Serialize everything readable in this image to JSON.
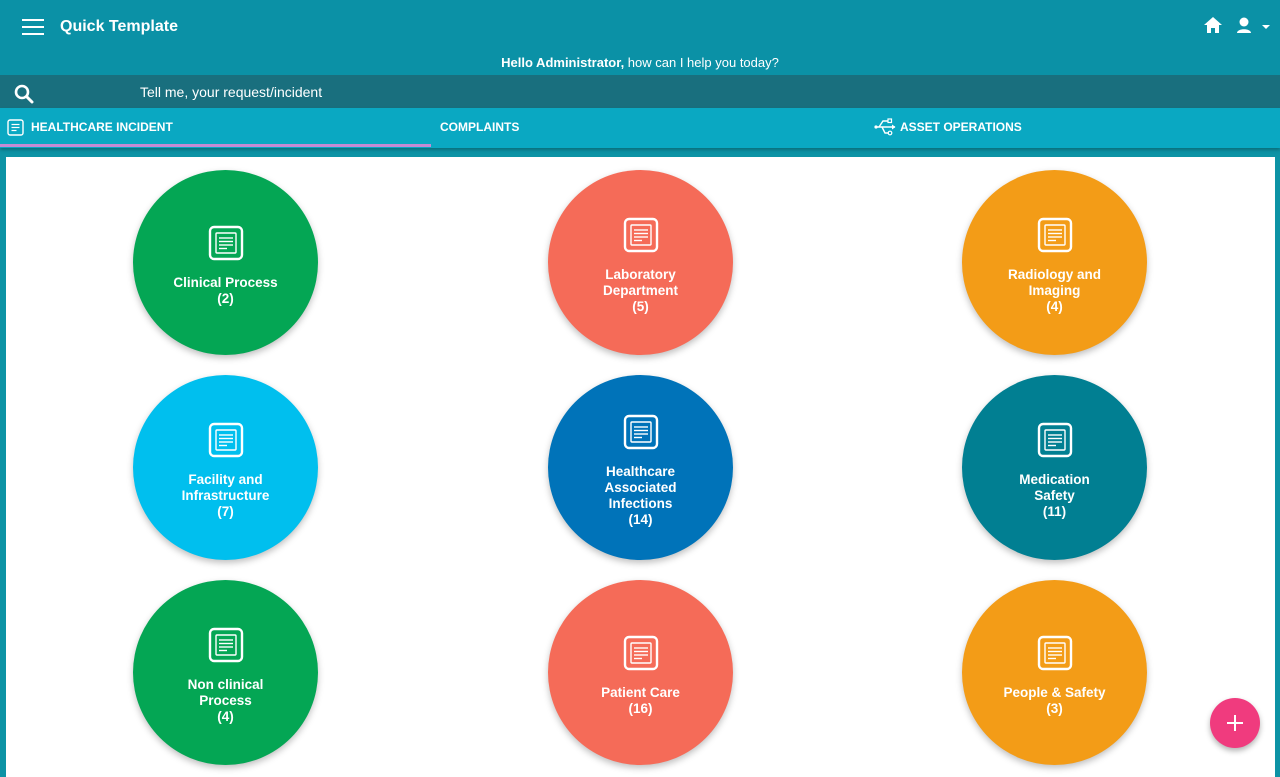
{
  "header": {
    "app_title": "Quick Template",
    "greeting_name": "Hello Administrator,",
    "greeting_rest": " how can I help you today?"
  },
  "search": {
    "placeholder": "Tell me, your request/incident"
  },
  "tabs": [
    {
      "label": "HEALTHCARE INCIDENT",
      "icon": "document-icon",
      "active": true
    },
    {
      "label": "COMPLAINTS",
      "active": false
    },
    {
      "label": "ASSET OPERATIONS",
      "icon": "usb-icon",
      "active": false
    }
  ],
  "tiles": [
    {
      "label": "Clinical Process",
      "count": "(2)",
      "color": "#04a654"
    },
    {
      "label": "Laboratory Department",
      "count": "(5)",
      "color": "#f56b58"
    },
    {
      "label": "Radiology and Imaging",
      "count": "(4)",
      "color": "#f39c17"
    },
    {
      "label": "Facility and Infrastructure",
      "count": "(7)",
      "color": "#00bfee"
    },
    {
      "label": "Healthcare Associated Infections",
      "count": "(14)",
      "color": "#0073b9"
    },
    {
      "label": "Medication Safety",
      "count": "(11)",
      "color": "#017f92"
    },
    {
      "label": "Non clinical Process",
      "count": "(4)",
      "color": "#04a654"
    },
    {
      "label": "Patient Care",
      "count": "(16)",
      "color": "#f56b58"
    },
    {
      "label": "People & Safety",
      "count": "(3)",
      "color": "#f39c17"
    }
  ],
  "colors": {
    "header_bg": "#0b91a6",
    "search_bg": "#196f7e",
    "tabs_bg": "#0aa8c2",
    "active_tab_indicator": "#c58bd4",
    "fab": "#f03b7e"
  },
  "icons": {
    "menu": "hamburger-menu-icon",
    "home": "home-icon",
    "user": "user-icon",
    "search": "search-icon",
    "tile": "document-icon",
    "fab": "plus-icon"
  }
}
